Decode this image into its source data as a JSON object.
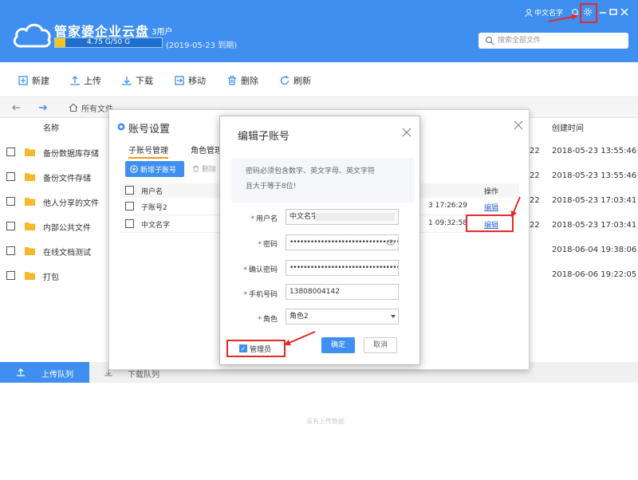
{
  "header": {
    "app_title": "管家婆企业云盘",
    "user_count": "3用户",
    "storage_text": "4.75 G/50 G",
    "storage_fraction": 0.095,
    "expiry": "(2019-05-23 到期)",
    "current_user": "中文名字",
    "search_placeholder": "搜索全部文件",
    "bg_color": "#3e8ff0"
  },
  "toolbar": {
    "new": "新建",
    "upload": "上传",
    "download": "下载",
    "move": "移动",
    "delete": "删除",
    "refresh": "刷新"
  },
  "path": {
    "current": "所有文件"
  },
  "file_list": {
    "col_name": "名称",
    "col_created": "创建时间",
    "rows": [
      {
        "name": "备份数据库存储",
        "cut_value": "22",
        "created": "2018-05-23 13:55:46"
      },
      {
        "name": "备份文件存储",
        "cut_value": "22",
        "created": "2018-05-23 13:55:46"
      },
      {
        "name": "他人分享的文件",
        "cut_value": "22",
        "created": "2018-05-23 17:03:41"
      },
      {
        "name": "内部公共文件",
        "cut_value": "22",
        "created": "2018-05-23 17:03:41"
      },
      {
        "name": "在线文档测试",
        "cut_value": "",
        "created": "2018-06-04 19:38:06"
      },
      {
        "name": "打包",
        "cut_value": "",
        "created": "2018-06-06 19:22:05"
      }
    ]
  },
  "queue": {
    "upload": "上传队列",
    "download": "下载队列",
    "empty": "没有上传数据"
  },
  "account_dialog": {
    "title": "账号设置",
    "tab_sub": "子账号管理",
    "tab_role": "角色管理",
    "add_button": "新增子账号",
    "delete_button": "删除",
    "col_username": "用户名",
    "col_action": "操作",
    "rows": [
      {
        "username": "子账号2",
        "time": "3 17:26:29",
        "action": "编辑"
      },
      {
        "username": "中文名字",
        "time": "1 09:32:58",
        "action": "编辑"
      }
    ]
  },
  "edit_dialog": {
    "title": "编辑子账号",
    "tip_line1": "密码必须包含数字、英文字母、英文字符",
    "tip_line2": "且大于等于8位!",
    "username_label": "用户名",
    "username_value": "中文名字",
    "password_label": "密码",
    "password_value": "••••••••••••••••••••••••••••••••••",
    "confirm_label": "确认密码",
    "confirm_value": "••••••••••••••••••••••••••••••••••",
    "phone_label": "手机号码",
    "phone_value": "13808004142",
    "role_label": "角色",
    "role_value": "角色2",
    "admin_label": "管理员",
    "admin_checked": true,
    "ok": "确定",
    "cancel": "取消"
  }
}
